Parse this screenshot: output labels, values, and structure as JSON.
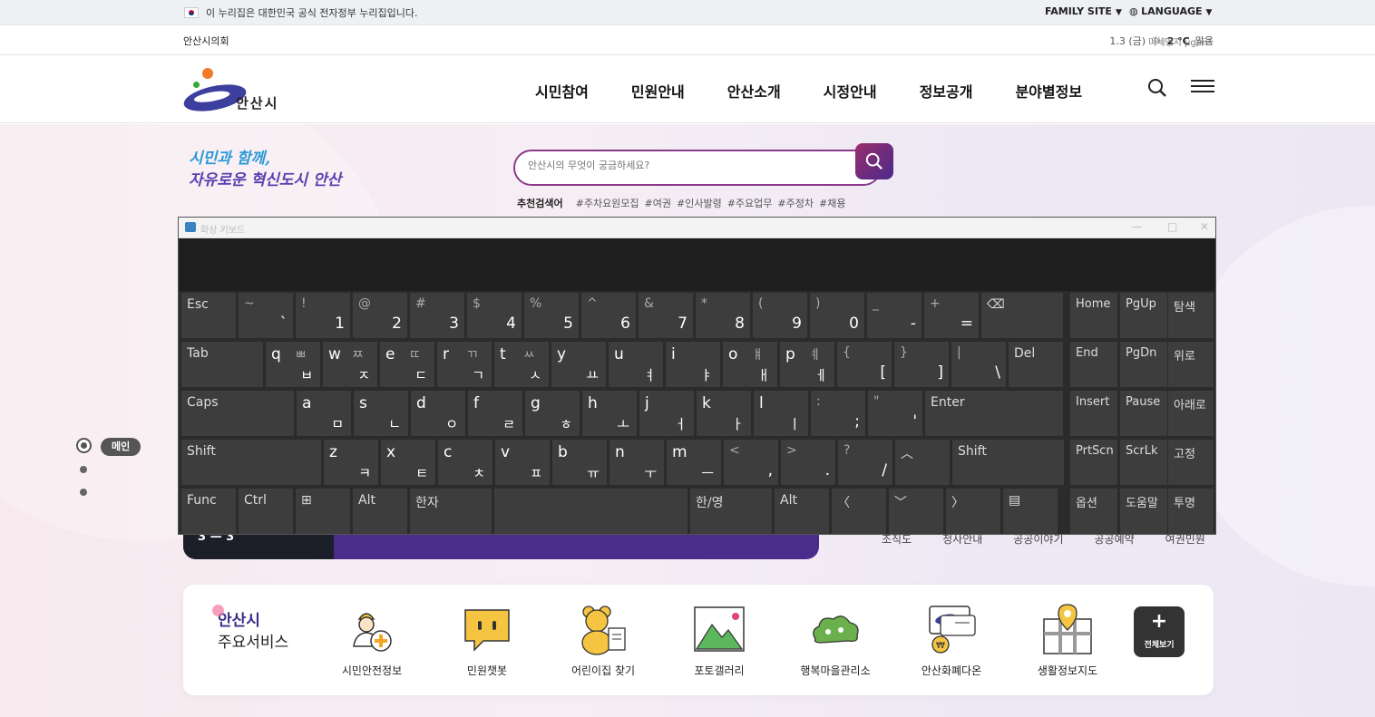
{
  "topbar": {
    "gov_notice": "이 누리집은 대한민국 공식 전자정부 누리집입니다.",
    "family_site": "FAMILY SITE",
    "language": "LANGUAGE"
  },
  "infobar": {
    "council": "안산시의회",
    "date": "1.3 (금)",
    "temperature": "2 °C",
    "condition": "맑음",
    "dust": "미세먼지 μg/m³"
  },
  "header": {
    "logo_text": "안산시",
    "nav": [
      "시민참여",
      "민원안내",
      "안산소개",
      "시정안내",
      "정보공개",
      "분야별정보"
    ]
  },
  "hero": {
    "slogan_line1": "시민과 함께,",
    "slogan_line2": "자유로운 혁신도시 안산",
    "search_placeholder": "안산시의 무엇이 궁금하세요?",
    "rec_title": "추천검색어",
    "rec_tags": [
      "#주차요원모집",
      "#여권",
      "#인사발령",
      "#주요업무",
      "#주정차",
      "#채용"
    ],
    "indicator_label": "메인",
    "banner_counter": "3 — 3",
    "quick_links": [
      "조직도",
      "청사안내",
      "공공이야기",
      "공공예약",
      "여권민원"
    ]
  },
  "keyboard": {
    "title": "화상 키보드",
    "rows": [
      [
        {
          "l": "Esc"
        },
        {
          "t": "~",
          "b": "`"
        },
        {
          "t": "!",
          "b": "1"
        },
        {
          "t": "@",
          "b": "2"
        },
        {
          "t": "#",
          "b": "3"
        },
        {
          "t": "$",
          "b": "4"
        },
        {
          "t": "%",
          "b": "5"
        },
        {
          "t": "^",
          "b": "6"
        },
        {
          "t": "&",
          "b": "7"
        },
        {
          "t": "*",
          "b": "8"
        },
        {
          "t": "(",
          "b": "9"
        },
        {
          "t": ")",
          "b": "0"
        },
        {
          "t": "_",
          "b": "-"
        },
        {
          "t": "+",
          "b": "="
        },
        {
          "l": "⌫"
        }
      ],
      [
        {
          "l": "Tab"
        },
        {
          "k": "q",
          "t": "ㅃ",
          "b": "ㅂ"
        },
        {
          "k": "w",
          "t": "ㅉ",
          "b": "ㅈ"
        },
        {
          "k": "e",
          "t": "ㄸ",
          "b": "ㄷ"
        },
        {
          "k": "r",
          "t": "ㄲ",
          "b": "ㄱ"
        },
        {
          "k": "t",
          "t": "ㅆ",
          "b": "ㅅ"
        },
        {
          "k": "y",
          "b": "ㅛ"
        },
        {
          "k": "u",
          "b": "ㅕ"
        },
        {
          "k": "i",
          "b": "ㅑ"
        },
        {
          "k": "o",
          "t": "ㅒ",
          "b": "ㅐ"
        },
        {
          "k": "p",
          "t": "ㅖ",
          "b": "ㅔ"
        },
        {
          "t": "{",
          "b": "["
        },
        {
          "t": "}",
          "b": "]"
        },
        {
          "t": "|",
          "b": "\\"
        },
        {
          "l": "Del"
        }
      ],
      [
        {
          "l": "Caps"
        },
        {
          "k": "a",
          "b": "ㅁ"
        },
        {
          "k": "s",
          "b": "ㄴ"
        },
        {
          "k": "d",
          "b": "ㅇ"
        },
        {
          "k": "f",
          "b": "ㄹ"
        },
        {
          "k": "g",
          "b": "ㅎ"
        },
        {
          "k": "h",
          "b": "ㅗ"
        },
        {
          "k": "j",
          "b": "ㅓ"
        },
        {
          "k": "k",
          "b": "ㅏ"
        },
        {
          "k": "l",
          "b": "ㅣ"
        },
        {
          "t": ":",
          "b": ";"
        },
        {
          "t": "\"",
          "b": "'"
        },
        {
          "l": "Enter"
        }
      ],
      [
        {
          "l": "Shift"
        },
        {
          "k": "z",
          "b": "ㅋ"
        },
        {
          "k": "x",
          "b": "ㅌ"
        },
        {
          "k": "c",
          "b": "ㅊ"
        },
        {
          "k": "v",
          "b": "ㅍ"
        },
        {
          "k": "b",
          "b": "ㅠ"
        },
        {
          "k": "n",
          "b": "ㅜ"
        },
        {
          "k": "m",
          "b": "ㅡ"
        },
        {
          "t": "<",
          "b": ","
        },
        {
          "t": ">",
          "b": "."
        },
        {
          "t": "?",
          "b": "/"
        },
        {
          "l": "︿"
        },
        {
          "l": "Shift"
        }
      ],
      [
        {
          "l": "Func"
        },
        {
          "l": "Ctrl"
        },
        {
          "l": "⊞"
        },
        {
          "l": "Alt"
        },
        {
          "l": "한자"
        },
        {
          "l": ""
        },
        {
          "l": "한/영"
        },
        {
          "l": "Alt"
        },
        {
          "l": "〈"
        },
        {
          "l": "﹀"
        },
        {
          "l": "〉"
        },
        {
          "l": "▤"
        }
      ]
    ],
    "side": [
      [
        "Home",
        "PgUp",
        "탐색"
      ],
      [
        "End",
        "PgDn",
        "위로"
      ],
      [
        "Insert",
        "Pause",
        "아래로"
      ],
      [
        "PrtScn",
        "ScrLk",
        "고정"
      ],
      [
        "옵션",
        "도움말",
        "투명"
      ]
    ]
  },
  "services": {
    "title_line1": "안산시",
    "title_line2": "주요서비스",
    "items": [
      {
        "label": "시민안전정보",
        "icon": "safety-worker-icon"
      },
      {
        "label": "민원챗봇",
        "icon": "chatbot-icon"
      },
      {
        "label": "어린이집 찾기",
        "icon": "teddy-bear-icon"
      },
      {
        "label": "포토갤러리",
        "icon": "photo-gallery-icon"
      },
      {
        "label": "행복마을관리소",
        "icon": "village-cloud-icon"
      },
      {
        "label": "안산화폐다온",
        "icon": "currency-card-icon"
      },
      {
        "label": "생활정보지도",
        "icon": "map-pin-icon"
      }
    ],
    "all_label": "전체보기"
  },
  "colors": {
    "accent": "#4a2d8a",
    "search_border": "#8a3a8a",
    "keyboard_bg": "#2b2b2b",
    "key_bg": "#3d3d3d"
  }
}
